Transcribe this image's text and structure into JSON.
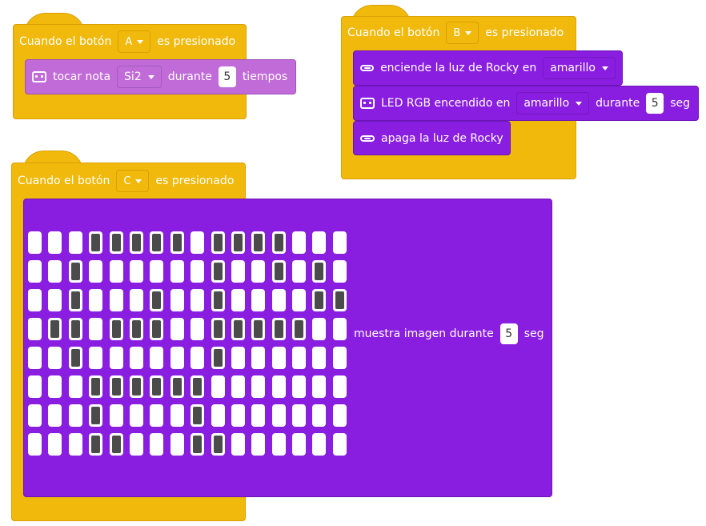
{
  "colors": {
    "events": "#f0b90b",
    "sound": "#c06bd8",
    "looks": "#8a1ee0",
    "led_off": "#ffffff",
    "led_on": "#4b4b4b"
  },
  "blocks": {
    "a": {
      "when": "Cuando el botón",
      "button": "A",
      "pressed": "es presionado",
      "play_note": {
        "icon": "robot-face-icon",
        "label": "tocar nota",
        "note": "Si2",
        "during": "durante",
        "value": "5",
        "unit": "tiempos"
      }
    },
    "b": {
      "when": "Cuando el botón",
      "button": "B",
      "pressed": "es presionado",
      "light_on": {
        "icon": "light-strip-icon",
        "label": "enciende la luz de Rocky en",
        "color": "amarillo"
      },
      "rgb": {
        "icon": "robot-face-icon",
        "label": "LED RGB encendido en",
        "color": "amarillo",
        "during": "durante",
        "value": "5",
        "unit": "seg"
      },
      "light_off": {
        "icon": "light-strip-icon",
        "label": "apaga la luz de Rocky"
      }
    },
    "c": {
      "when": "Cuando el botón",
      "button": "C",
      "pressed": "es presionado",
      "show_image": {
        "label": "muestra imagen durante",
        "value": "5",
        "unit": "seg",
        "matrix": [
          [
            0,
            0,
            0,
            1,
            1,
            1,
            1,
            1,
            0,
            1,
            1,
            1,
            1,
            0,
            0,
            0
          ],
          [
            0,
            0,
            1,
            0,
            0,
            0,
            0,
            0,
            0,
            1,
            0,
            0,
            1,
            0,
            1,
            0
          ],
          [
            0,
            0,
            1,
            0,
            0,
            0,
            1,
            0,
            0,
            1,
            0,
            0,
            0,
            0,
            1,
            1
          ],
          [
            0,
            1,
            1,
            0,
            1,
            1,
            1,
            0,
            0,
            1,
            1,
            1,
            1,
            1,
            0,
            0
          ],
          [
            0,
            0,
            1,
            0,
            0,
            0,
            0,
            0,
            0,
            1,
            0,
            0,
            0,
            0,
            0,
            0
          ],
          [
            0,
            0,
            0,
            1,
            1,
            1,
            1,
            1,
            1,
            0,
            0,
            0,
            0,
            0,
            0,
            0
          ],
          [
            0,
            0,
            0,
            1,
            0,
            0,
            0,
            0,
            1,
            0,
            0,
            0,
            0,
            0,
            0,
            0
          ],
          [
            0,
            0,
            0,
            1,
            1,
            0,
            0,
            0,
            1,
            1,
            0,
            0,
            0,
            0,
            0,
            0
          ]
        ]
      }
    }
  }
}
